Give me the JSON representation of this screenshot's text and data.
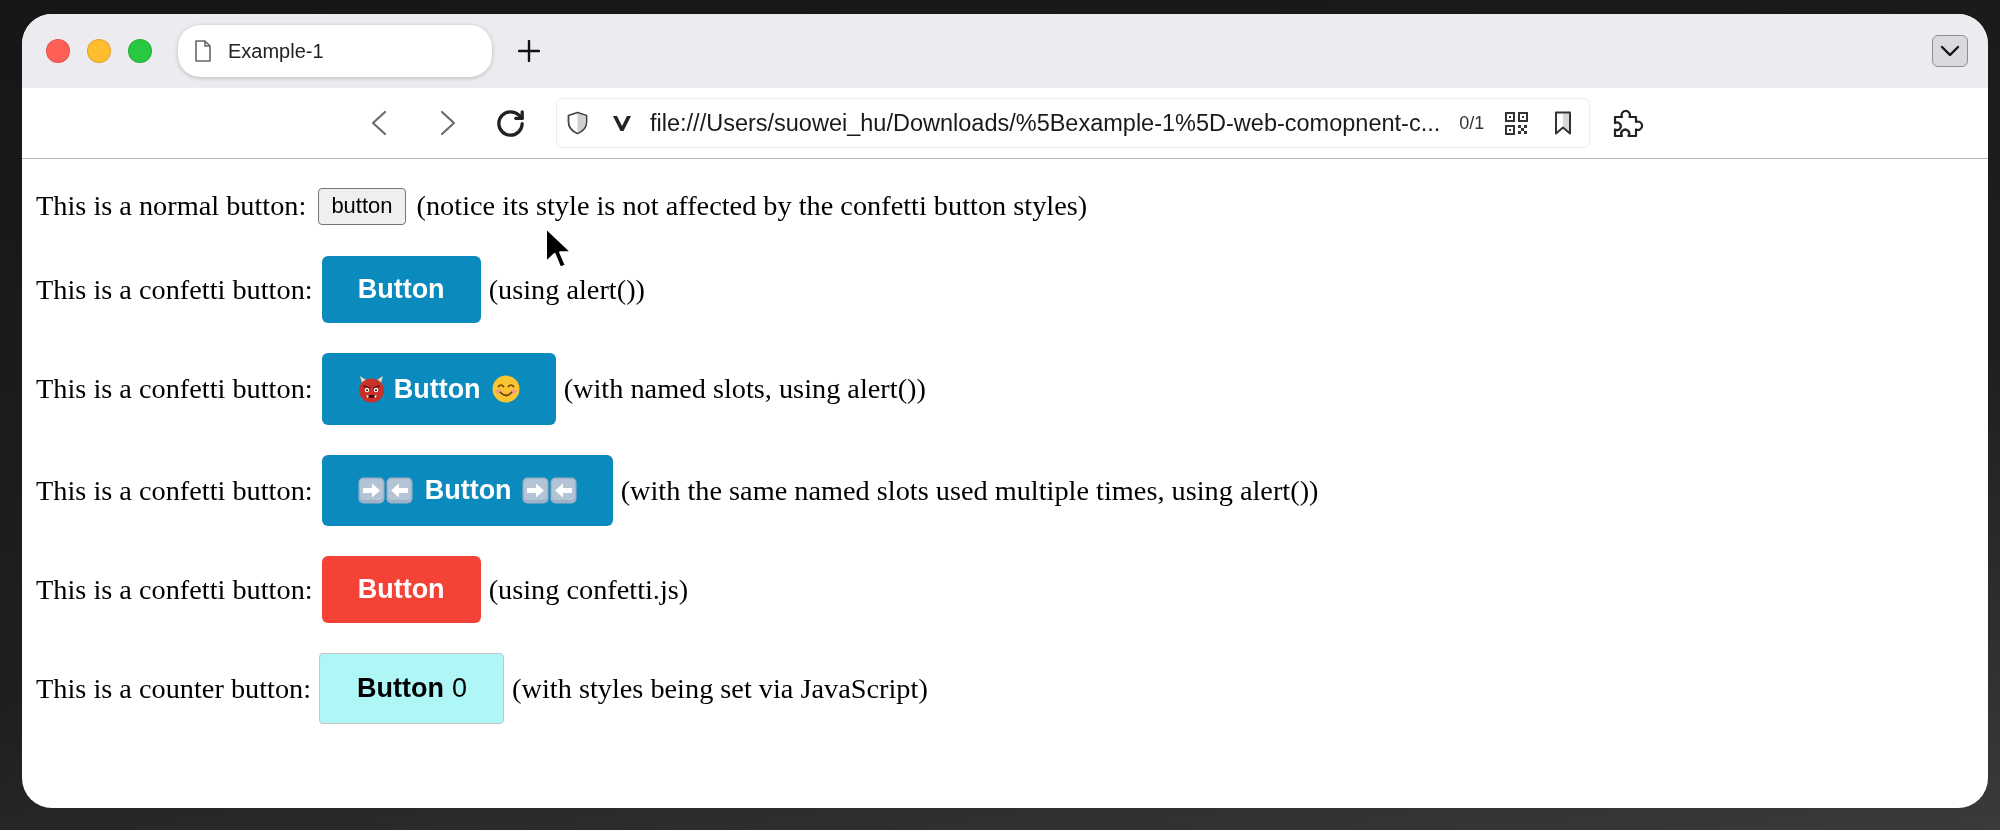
{
  "browser": {
    "tabs": [
      {
        "title": "Example-1",
        "selected": true
      }
    ],
    "address_bar": {
      "url": "file:///Users/suowei_hu/Downloads/%5Bexample-1%5D-web-comopnent-c...",
      "indicator": "0/1"
    }
  },
  "rows": [
    {
      "label": "This is a normal button:",
      "button": {
        "kind": "native",
        "text": "button"
      },
      "note": "(notice its style is not affected by the confetti button styles)"
    },
    {
      "label": "This is a confetti button:",
      "button": {
        "kind": "plain",
        "text": "Button",
        "color": "#0b8bbd"
      },
      "note": "(using alert())"
    },
    {
      "label": "This is a confetti button:",
      "button": {
        "kind": "face-slots",
        "text": "Button",
        "color": "#0b8bbd"
      },
      "note": "(with named slots, using alert())"
    },
    {
      "label": "This is a confetti button:",
      "button": {
        "kind": "arrow-slots",
        "text": "Button",
        "color": "#0b8bbd"
      },
      "note": "(with the same named slots used multiple times, using alert())"
    },
    {
      "label": "This is a confetti button:",
      "button": {
        "kind": "plain",
        "text": "Button",
        "color": "#f44336"
      },
      "note": "(using confetti.js)"
    },
    {
      "label": "This is a counter button:",
      "button": {
        "kind": "counter",
        "text": "Button",
        "count": "0",
        "color": "#aff6f7"
      },
      "note": "(with styles being set via JavaScript)"
    }
  ]
}
